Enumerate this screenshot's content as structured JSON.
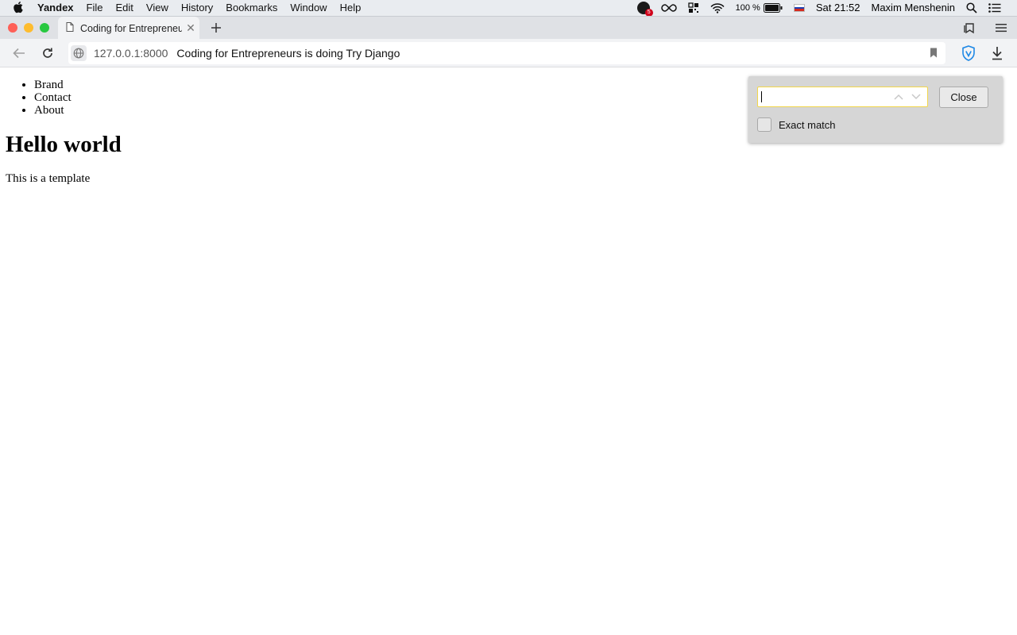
{
  "menubar": {
    "app_name": "Yandex",
    "items": [
      "File",
      "Edit",
      "View",
      "History",
      "Bookmarks",
      "Window",
      "Help"
    ],
    "status": {
      "notification_count": "5",
      "battery": "100 %",
      "clock": "Sat 21:52",
      "user": "Maxim Menshenin"
    }
  },
  "tabstrip": {
    "tab_title": "Coding for Entrepreneurs is doing Try Django"
  },
  "toolbar": {
    "host": "127.0.0.1:8000",
    "page_title": "Coding for Entrepreneurs is doing Try Django"
  },
  "page": {
    "nav_items": [
      "Brand",
      "Contact",
      "About"
    ],
    "heading": "Hello world",
    "paragraph": "This is a template"
  },
  "find": {
    "close_label": "Close",
    "exact_label": "Exact match",
    "query": "",
    "accent_color": "#f2d64a"
  },
  "colors": {
    "close_red": "#fe5f57",
    "minimize_yellow": "#febc2e",
    "zoom_green": "#28c840",
    "shield_blue": "#1e88e5"
  }
}
